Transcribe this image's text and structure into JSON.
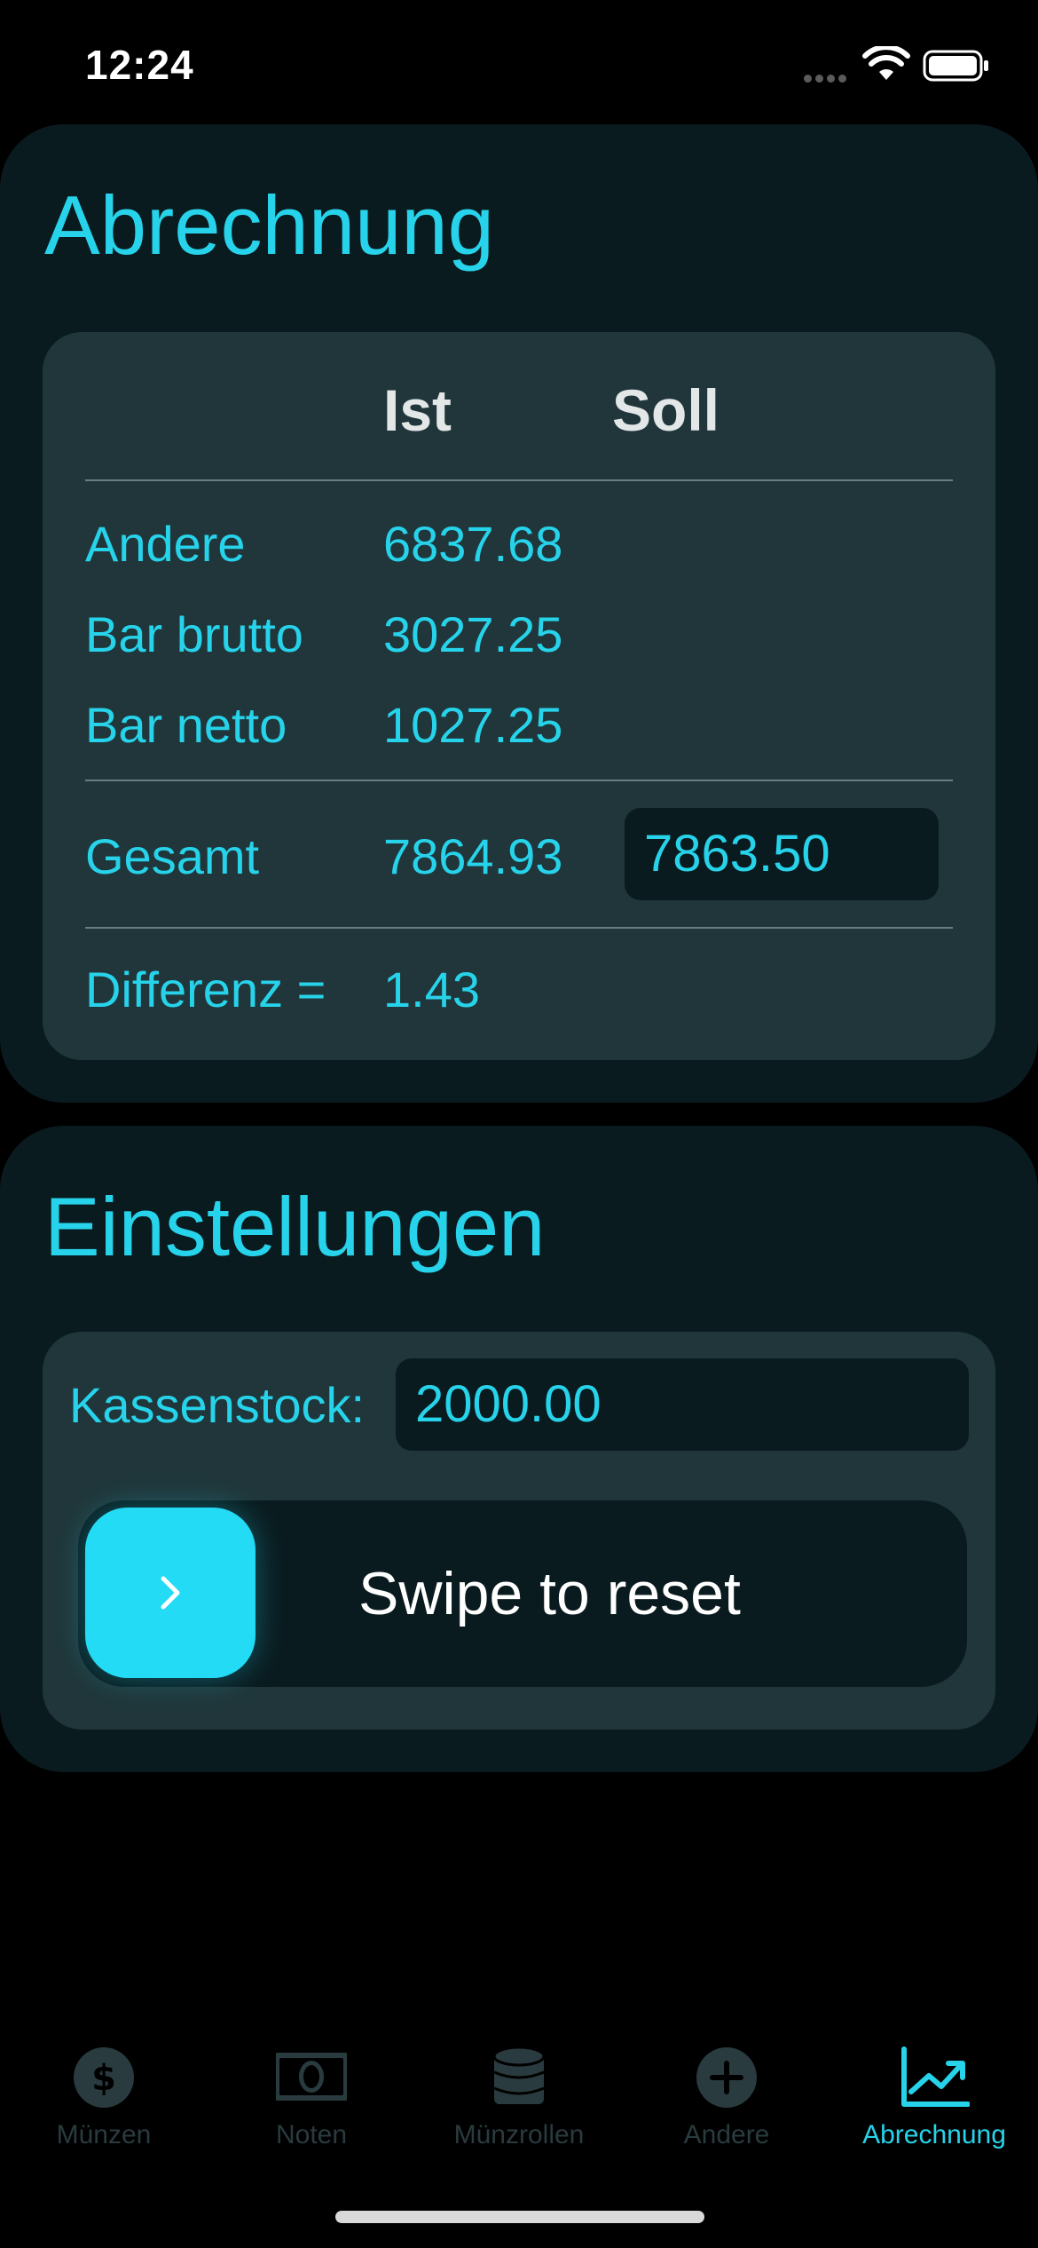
{
  "status_bar": {
    "time": "12:24"
  },
  "abrechnung": {
    "title": "Abrechnung",
    "headers": {
      "ist": "Ist",
      "soll": "Soll"
    },
    "rows": [
      {
        "label": "Andere",
        "ist": "6837.68"
      },
      {
        "label": "Bar brutto",
        "ist": "3027.25"
      },
      {
        "label": "Bar netto",
        "ist": "1027.25"
      }
    ],
    "gesamt": {
      "label": "Gesamt",
      "ist": "7864.93",
      "soll_value": "7863.50"
    },
    "differenz": {
      "label": "Differenz =",
      "value": "1.43"
    }
  },
  "einstellungen": {
    "title": "Einstellungen",
    "kassenstock_label": "Kassenstock:",
    "kassenstock_value": "2000.00",
    "swipe_label": "Swipe to reset"
  },
  "tab_bar": {
    "tabs": [
      {
        "label": "Münzen",
        "icon": "dollar-coin-icon"
      },
      {
        "label": "Noten",
        "icon": "banknote-icon"
      },
      {
        "label": "Münzrollen",
        "icon": "coin-stack-icon"
      },
      {
        "label": "Andere",
        "icon": "plus-circle-icon"
      },
      {
        "label": "Abrechnung",
        "icon": "chart-line-icon"
      }
    ],
    "active_index": 4
  },
  "colors": {
    "accent": "#27d3ea",
    "card_bg": "#0a1b1f",
    "panel_bg": "#20363a",
    "knob": "#23dbf4",
    "inactive_tab": "#2a3b3f"
  }
}
